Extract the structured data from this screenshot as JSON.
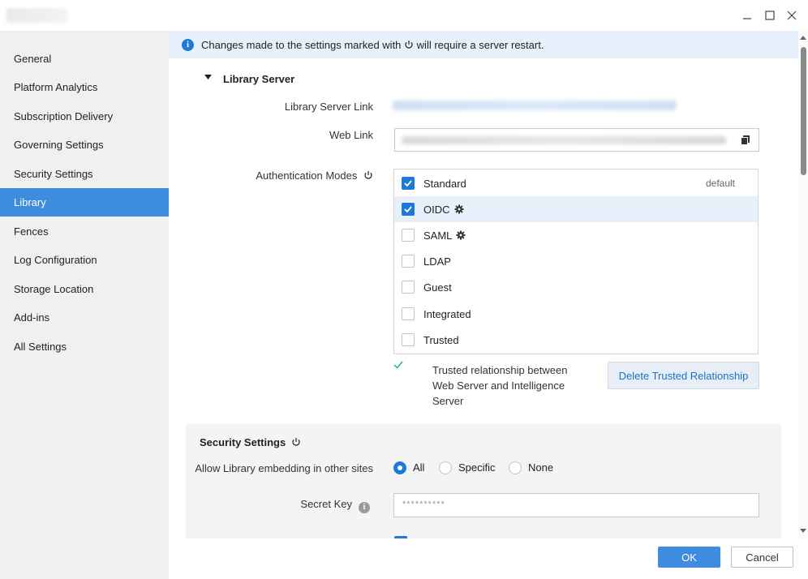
{
  "window": {
    "minimize": "—",
    "maximize": "☐",
    "close": "✕"
  },
  "sidebar": {
    "items": [
      {
        "label": "General",
        "active": false
      },
      {
        "label": "Platform Analytics",
        "active": false
      },
      {
        "label": "Subscription Delivery",
        "active": false
      },
      {
        "label": "Governing Settings",
        "active": false
      },
      {
        "label": "Security Settings",
        "active": false
      },
      {
        "label": "Library",
        "active": true
      },
      {
        "label": "Fences",
        "active": false
      },
      {
        "label": "Log Configuration",
        "active": false
      },
      {
        "label": "Storage Location",
        "active": false
      },
      {
        "label": "Add-ins",
        "active": false
      },
      {
        "label": "All Settings",
        "active": false
      }
    ]
  },
  "banner": {
    "text_before": "Changes made to the settings marked with",
    "text_after": "will require a server restart."
  },
  "library_server": {
    "title": "Library Server",
    "server_link_label": "Library Server Link",
    "web_link_label": "Web Link",
    "auth_modes_label": "Authentication Modes",
    "modes": [
      {
        "label": "Standard",
        "checked": true,
        "gear": false,
        "tag": "default"
      },
      {
        "label": "OIDC",
        "checked": true,
        "gear": true,
        "tag": ""
      },
      {
        "label": "SAML",
        "checked": false,
        "gear": true,
        "tag": ""
      },
      {
        "label": "LDAP",
        "checked": false,
        "gear": false,
        "tag": ""
      },
      {
        "label": "Guest",
        "checked": false,
        "gear": false,
        "tag": ""
      },
      {
        "label": "Integrated",
        "checked": false,
        "gear": false,
        "tag": ""
      },
      {
        "label": "Trusted",
        "checked": false,
        "gear": false,
        "tag": ""
      }
    ],
    "trusted_status": "Trusted relationship between Web Server and Intelligence Server",
    "delete_trusted_button": "Delete Trusted Relationship"
  },
  "security_settings": {
    "title": "Security Settings",
    "embedding_label": "Allow Library embedding in other sites",
    "embedding_options": [
      "All",
      "Specific",
      "None"
    ],
    "embedding_selected": "All",
    "secret_key_label": "Secret Key",
    "secret_key_value": "**********"
  },
  "footer": {
    "ok": "OK",
    "cancel": "Cancel"
  },
  "colors": {
    "accent": "#3d8ce0",
    "checkbox": "#1e7ad9",
    "banner_bg": "#e6f1fc",
    "success": "#2bb673"
  },
  "icons": [
    "info-icon",
    "power-icon",
    "gear-icon",
    "copy-icon",
    "checkmark-icon",
    "caret-down-icon"
  ]
}
